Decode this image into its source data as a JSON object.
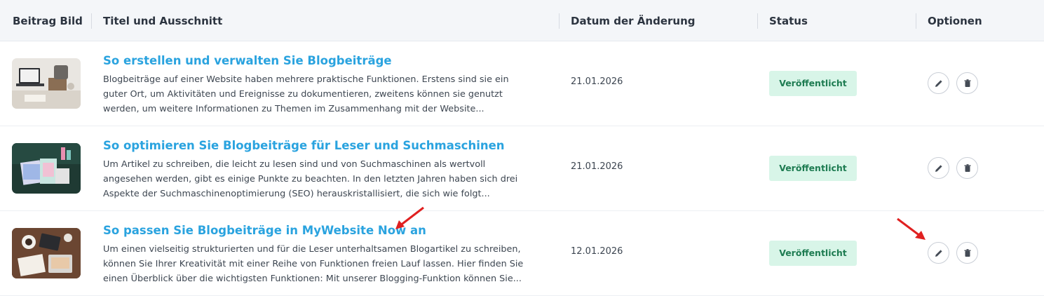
{
  "header": {
    "col_image": "Beitrag Bild",
    "col_title": "Titel und Ausschnitt",
    "col_date": "Datum der Änderung",
    "col_status": "Status",
    "col_options": "Optionen"
  },
  "rows": [
    {
      "title": "So erstellen und verwalten Sie Blogbeiträge",
      "excerpt": [
        "Blogbeiträge auf einer Website haben mehrere praktische Funktionen. Erstens sind sie ein",
        "guter Ort, um Aktivitäten und Ereignisse zu dokumentieren, zweitens können sie genutzt",
        "werden, um weitere Informationen zu Themen im Zusammenhang mit der Website..."
      ],
      "date": "21.01.2026",
      "status": "Veröffentlicht"
    },
    {
      "title": "So optimieren Sie Blogbeiträge für Leser und Suchmaschinen",
      "excerpt": [
        "Um Artikel zu schreiben, die leicht zu lesen sind und von Suchmaschinen als wertvoll",
        "angesehen werden, gibt es einige Punkte zu beachten. In den letzten Jahren haben sich drei",
        "Aspekte der Suchmaschinenoptimierung (SEO) herauskristallisiert, die sich wie folgt..."
      ],
      "date": "21.01.2026",
      "status": "Veröffentlicht"
    },
    {
      "title": "So passen Sie Blogbeiträge in MyWebsite Now an",
      "excerpt": [
        "Um einen vielseitig strukturierten und für die Leser unterhaltsamen Blogartikel zu schreiben,",
        "können Sie Ihrer Kreativität mit einer Reihe von Funktionen freien Lauf lassen. Hier finden Sie",
        "einen Überblick über die wichtigsten Funktionen: Mit unserer Blogging-Funktion können Sie..."
      ],
      "date": "12.01.2026",
      "status": "Veröffentlicht"
    }
  ],
  "icons": {
    "edit": "pencil-icon",
    "delete": "trash-icon",
    "annotation": "red-arrow"
  },
  "colors": {
    "link": "#2aa3df",
    "status_bg": "#d8f5e8",
    "status_text": "#1e7c52",
    "annotation": "#e02020"
  }
}
